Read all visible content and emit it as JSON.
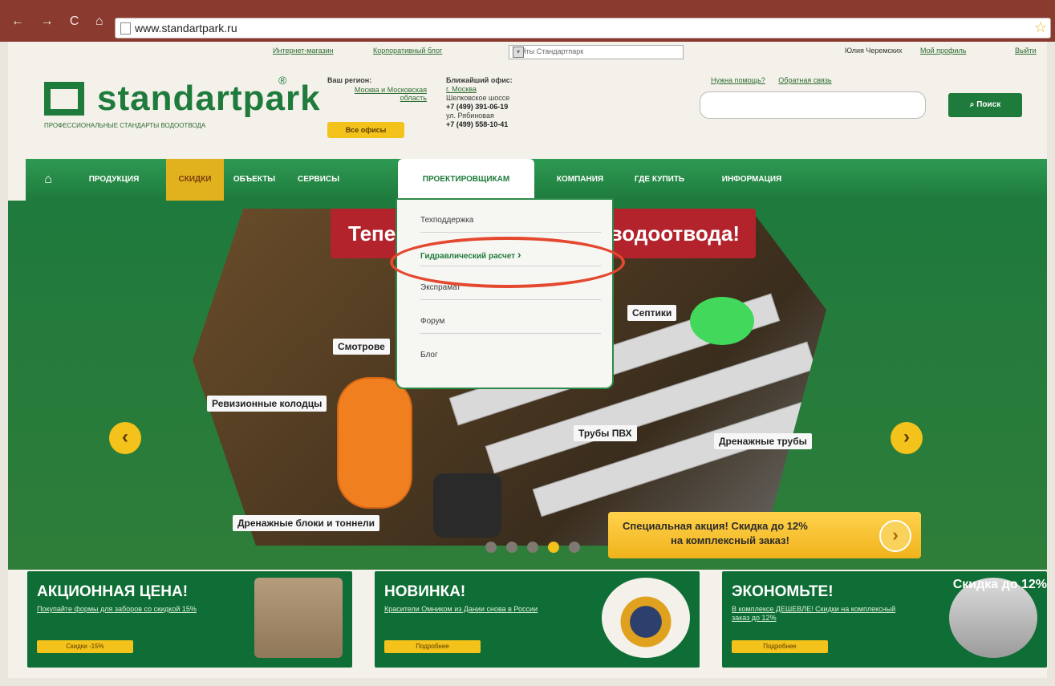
{
  "browser": {
    "url": "www.standartpark.ru"
  },
  "topbar": {
    "links": [
      "Интернет-магазин",
      "Корпоративный блог"
    ],
    "select": "Сайты Стандартпарк",
    "user": "Юлия Черемских",
    "profile": "Мой профиль",
    "logout": "Выйти"
  },
  "logo": {
    "text": "standartpark",
    "tagline": "ПРОФЕССИОНАЛЬНЫЕ СТАНДАРТЫ ВОДООТВОДА",
    "reg": "®"
  },
  "region": {
    "title": "Ваш регион:",
    "name": "Москва и Московская область",
    "button": "Все офисы"
  },
  "office": {
    "title": "Ближайший офис:",
    "city": "г. Москва",
    "line1": "Шелковское шоссе",
    "phone1": "+7 (499) 391-06-19",
    "line2": "ул. Рябиновая",
    "phone2": "+7 (499) 558-10-41"
  },
  "help": {
    "need_help": "Нужна помощь?",
    "feedback": "Обратная связь"
  },
  "search": {
    "button": "Поиск",
    "placeholder": ""
  },
  "menu": {
    "items": [
      "ПРОДУКЦИЯ",
      "СКИДКИ",
      "ОБЪЕКТЫ",
      "СЕРВИСЫ",
      "ПРОЕКТИРОВЩИКАМ",
      "КОМПАНИЯ",
      "ГДЕ КУПИТЬ",
      "ИНФОРМАЦИЯ"
    ]
  },
  "dropdown": {
    "items": [
      "Техподдержка",
      "Гидравлический расчет",
      "Экспрамат",
      "Форум",
      "Блог"
    ]
  },
  "hero": {
    "banner_left": "Тепе",
    "banner_right": "водоотвода!",
    "labels": [
      "Смотрове",
      "Ревизионные колодцы",
      "Септики",
      "Трубы ПВХ",
      "Дренажные трубы",
      "Дренажные блоки и тоннели"
    ]
  },
  "promo": {
    "line1": "Специальная акция! Скидка до 12%",
    "line2": "на комплексный заказ!"
  },
  "boxes": [
    {
      "title": "АКЦИОННАЯ ЦЕНА!",
      "text": "Покупайте формы для заборов со скидкой 15%",
      "button": "Скидки -15%"
    },
    {
      "title": "НОВИНКА!",
      "text": "Красители Омником из Дании снова в России",
      "button": "Подробнее"
    },
    {
      "title": "ЭКОНОМЬТЕ!",
      "text": "В комплексе ДЕШЕВЛЕ! Скидки на комплексный заказ до 12%",
      "button": "Подробнее",
      "corner": "Скидка до 12%"
    }
  ],
  "colors": {
    "green": "#1f7b3c",
    "yellow": "#f3c21b",
    "red": "#b3232c"
  }
}
